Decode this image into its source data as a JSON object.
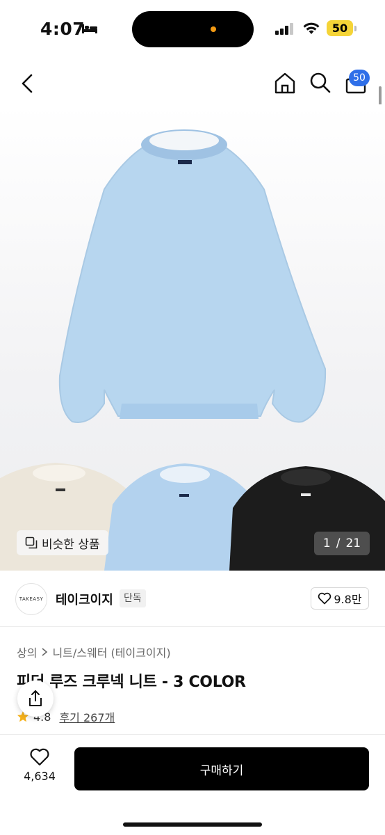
{
  "status_bar": {
    "time": "4:07",
    "battery": "50"
  },
  "nav": {
    "cart_count": "50"
  },
  "gallery": {
    "similar_label": "비슷한 상품",
    "current_page": "1",
    "separator": "/",
    "total_pages": "21",
    "colors": {
      "main": "#b7d6ef",
      "thumb_cream": "#ece6da",
      "thumb_blue": "#b3d2ee",
      "thumb_black": "#1c1c1c"
    }
  },
  "brand": {
    "logo_text": "TAKEASY",
    "name": "테이크이지",
    "badge": "단독",
    "likes": "9.8만"
  },
  "breadcrumb": {
    "items": [
      "상의",
      "니트/스웨터 (테이크이지)"
    ]
  },
  "product": {
    "title": "피더 루즈 크루넥 니트 - 3 COLOR",
    "rating": "4.8",
    "reviews": "후기 267개"
  },
  "bottom_bar": {
    "wish_count": "4,634",
    "buy_label": "구매하기"
  },
  "icons": [
    "bed-icon",
    "signal-icon",
    "wifi-icon",
    "back-icon",
    "home-icon",
    "search-icon",
    "cart-icon",
    "share-icon",
    "heart-icon",
    "star-icon",
    "chevron-right-icon",
    "similar-items-icon"
  ]
}
